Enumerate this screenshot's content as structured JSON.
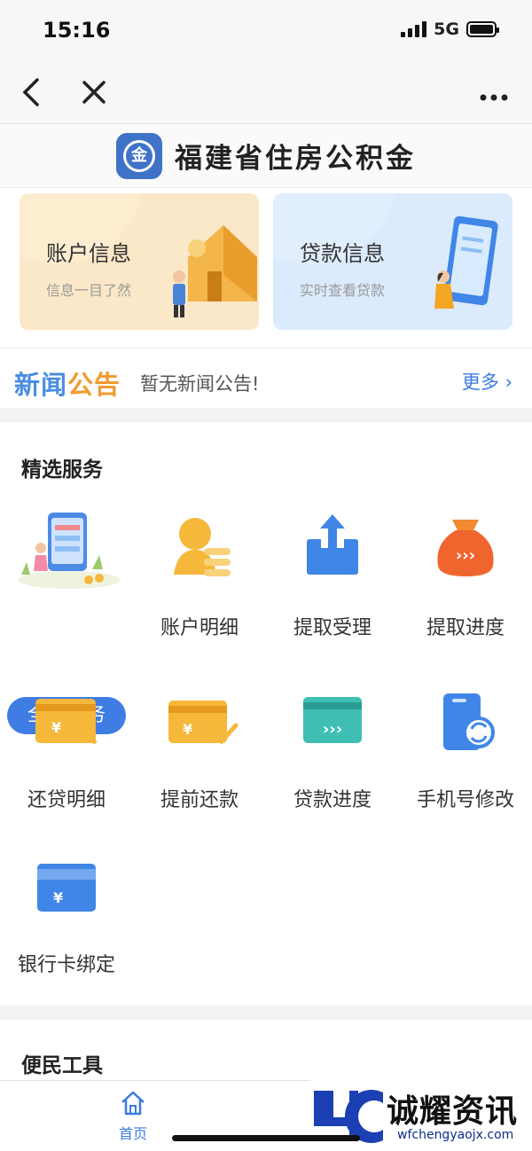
{
  "status_bar": {
    "time": "15:16",
    "network": "5G"
  },
  "nav": {
    "back_icon": "chevron-left-icon",
    "close_icon": "close-icon",
    "more_icon": "more-dots-icon"
  },
  "brand": {
    "title": "福建省住房公积金",
    "logo_text": "金"
  },
  "cards": [
    {
      "title": "账户信息",
      "subtitle": "信息一目了然"
    },
    {
      "title": "贷款信息",
      "subtitle": "实时查看贷款"
    }
  ],
  "news": {
    "logo_part1": "新闻",
    "logo_part2": "公告",
    "text": "暂无新闻公告!",
    "more": "更多 ›"
  },
  "featured": {
    "title": "精选服务",
    "items": [
      {
        "label": "全部服务",
        "icon": "all-services-icon"
      },
      {
        "label": "账户明细",
        "icon": "account-detail-icon"
      },
      {
        "label": "提取受理",
        "icon": "withdraw-apply-icon"
      },
      {
        "label": "提取进度",
        "icon": "withdraw-progress-icon"
      },
      {
        "label": "还贷明细",
        "icon": "repay-detail-icon"
      },
      {
        "label": "提前还款",
        "icon": "prepay-icon"
      },
      {
        "label": "贷款进度",
        "icon": "loan-progress-icon"
      },
      {
        "label": "手机号修改",
        "icon": "phone-change-icon"
      },
      {
        "label": "银行卡绑定",
        "icon": "bank-card-bind-icon"
      }
    ]
  },
  "tools": {
    "title": "便民工具"
  },
  "tab_bar": {
    "home_label": "首页"
  },
  "watermark": {
    "name": "诚耀资讯",
    "url": "wfchengyaojx.com"
  },
  "colors": {
    "accent": "#3f7de4",
    "orange": "#f29b2f",
    "gold": "#f5b83a"
  }
}
